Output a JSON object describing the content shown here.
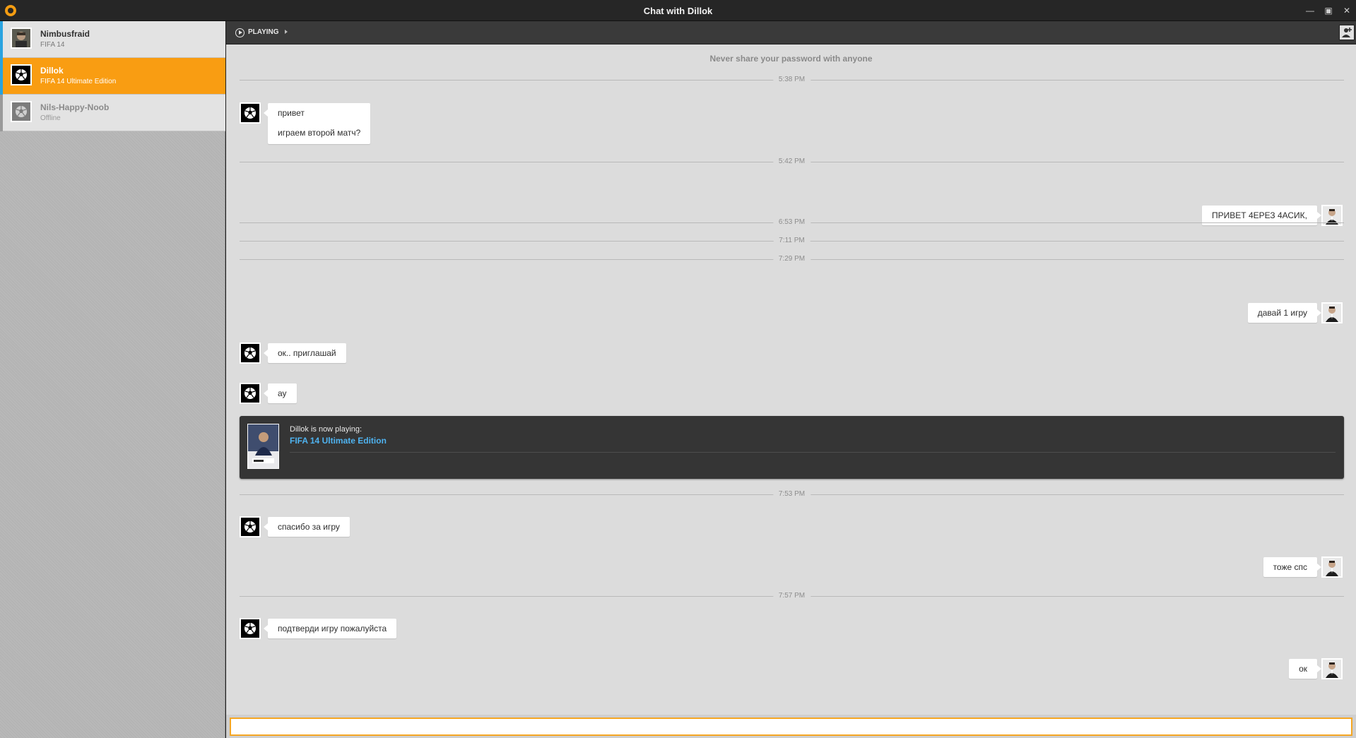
{
  "window": {
    "title": "Chat with Dillok",
    "minimize_label": "—",
    "maximize_label": "▣",
    "close_label": "✕"
  },
  "colors": {
    "accent_orange": "#f99d12",
    "online_blue": "#29a3e0",
    "link_blue": "#4fb3f0",
    "toolbar_dark": "#3a3a3a"
  },
  "sidebar": {
    "contacts": [
      {
        "name": "Nimbusfraid",
        "status": "FIFA 14",
        "state": "online",
        "icon": "user-photo-avatar"
      },
      {
        "name": "Dillok",
        "status": "FIFA 14 Ultimate Edition",
        "state": "selected",
        "icon": "soccer-ball-avatar"
      },
      {
        "name": "Nils-Happy-Noob",
        "status": "Offline",
        "state": "offline",
        "icon": "soccer-ball-avatar"
      }
    ]
  },
  "toolbar": {
    "playing_label": "PLAYING",
    "add_friend_icon": "add-friend-icon"
  },
  "chat": {
    "notice": "Never share your password with anyone",
    "timestamps": [
      "5:38 PM",
      "5:42 PM",
      "6:53 PM",
      "7:11 PM",
      "7:29 PM",
      "7:53 PM",
      "7:57 PM"
    ],
    "messages": [
      {
        "from": "Dillok",
        "side": "left",
        "lines": [
          "привет",
          "играем второй матч?"
        ]
      },
      {
        "from": "me",
        "side": "right",
        "text": "ПРИВЕТ 4ЕРЕЗ 4АСИК,"
      },
      {
        "from": "me",
        "side": "right",
        "text": "давай 1 игру"
      },
      {
        "from": "Dillok",
        "side": "left",
        "text": "ок.. приглашай"
      },
      {
        "from": "Dillok",
        "side": "left",
        "text": "ау"
      },
      {
        "from": "Dillok",
        "side": "left",
        "text": "спасибо за игру"
      },
      {
        "from": "me",
        "side": "right",
        "text": "тоже спс"
      },
      {
        "from": "Dillok",
        "side": "left",
        "text": "подтверди игру пожалуйста"
      },
      {
        "from": "me",
        "side": "right",
        "text": "ок"
      }
    ],
    "now_playing": {
      "label": "Dillok is now playing:",
      "game": "FIFA 14 Ultimate Edition"
    }
  },
  "input": {
    "value": "",
    "placeholder": ""
  }
}
